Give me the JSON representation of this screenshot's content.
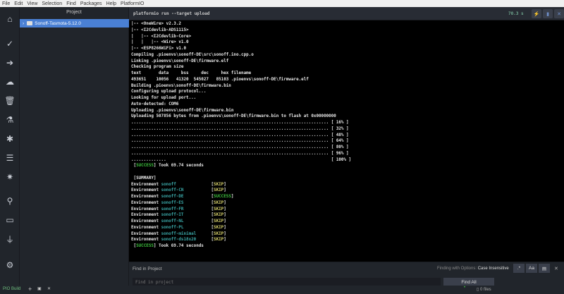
{
  "menu": [
    "File",
    "Edit",
    "View",
    "Selection",
    "Find",
    "Packages",
    "Help",
    "PlatformIO"
  ],
  "sidebar_icons": [
    "home-icon",
    "check-icon",
    "arrow-right-icon",
    "cloud-upload-icon",
    "trash-icon",
    "flask-icon",
    "bug-icon",
    "checklist-icon",
    "gear-icon",
    "search-icon",
    "terminal-icon",
    "plug-icon",
    "settings-icon"
  ],
  "project": {
    "title": "Project",
    "item": "Sonoff-Tasmota-5.12.0"
  },
  "terminal": {
    "command": "platformio run --target upload",
    "elapsed": "70.3 s",
    "lines": [
      "|-- <OneWire> v2.3.2",
      "|-- <I2Cdevlib-ADS1115>",
      "|   |-- <I2Cdevlib-Core>",
      "|   |   |-- <Wire> v1.0",
      "|-- <ESP8266WiFi> v1.0",
      "Compiling .pioenvs\\sonoff-DE\\src\\sonoff.ino.cpp.o",
      "Linking .pioenvs\\sonoff-DE\\firmware.elf",
      "Checking program size",
      "text       data     bss     dec     hex filename",
      "493651    10056   41320  545027   85103 .pioenvs\\sonoff-DE\\firmware.elf",
      "Building .pioenvs\\sonoff-DE\\firmware.bin",
      "Configuring upload protocol...",
      "Looking for upload port...",
      "Auto-detected: COM6",
      "Uploading .pioenvs\\sonoff-DE\\firmware.bin",
      "Uploading 507856 bytes from .pioenvs\\sonoff-DE\\firmware.bin to flash at 0x00000000"
    ],
    "progress": [
      "16%",
      "32%",
      "48%",
      "64%",
      "80%",
      "96%",
      "100%"
    ],
    "success_label": "SUCCESS",
    "took": "Took 69.74 seconds",
    "summary_label": "[SUMMARY]",
    "env_label": "Environment",
    "envs": [
      {
        "name": "sonoff",
        "status": "SKIP"
      },
      {
        "name": "sonoff-CN",
        "status": "SKIP"
      },
      {
        "name": "sonoff-DE",
        "status": "SUCCESS"
      },
      {
        "name": "sonoff-ES",
        "status": "SKIP"
      },
      {
        "name": "sonoff-FR",
        "status": "SKIP"
      },
      {
        "name": "sonoff-IT",
        "status": "SKIP"
      },
      {
        "name": "sonoff-NL",
        "status": "SKIP"
      },
      {
        "name": "sonoff-PL",
        "status": "SKIP"
      },
      {
        "name": "sonoff-minimal",
        "status": "SKIP"
      },
      {
        "name": "sonoff-ds18x20",
        "status": "SKIP"
      }
    ]
  },
  "find": {
    "title": "Find in Project",
    "options_prefix": "Finding with Options:",
    "options_value": "Case Insensitive",
    "regex": ".*",
    "case": "Aa",
    "word": "▤",
    "placeholder": "Find in project",
    "find_all": "Find All"
  },
  "status": {
    "pio_build": "PIO Build",
    "files": "0 files"
  },
  "colors": {
    "success": "#3ec43e",
    "skip": "#d6d06a",
    "env": "#3aa7a7",
    "accent": "#4a80d4"
  }
}
